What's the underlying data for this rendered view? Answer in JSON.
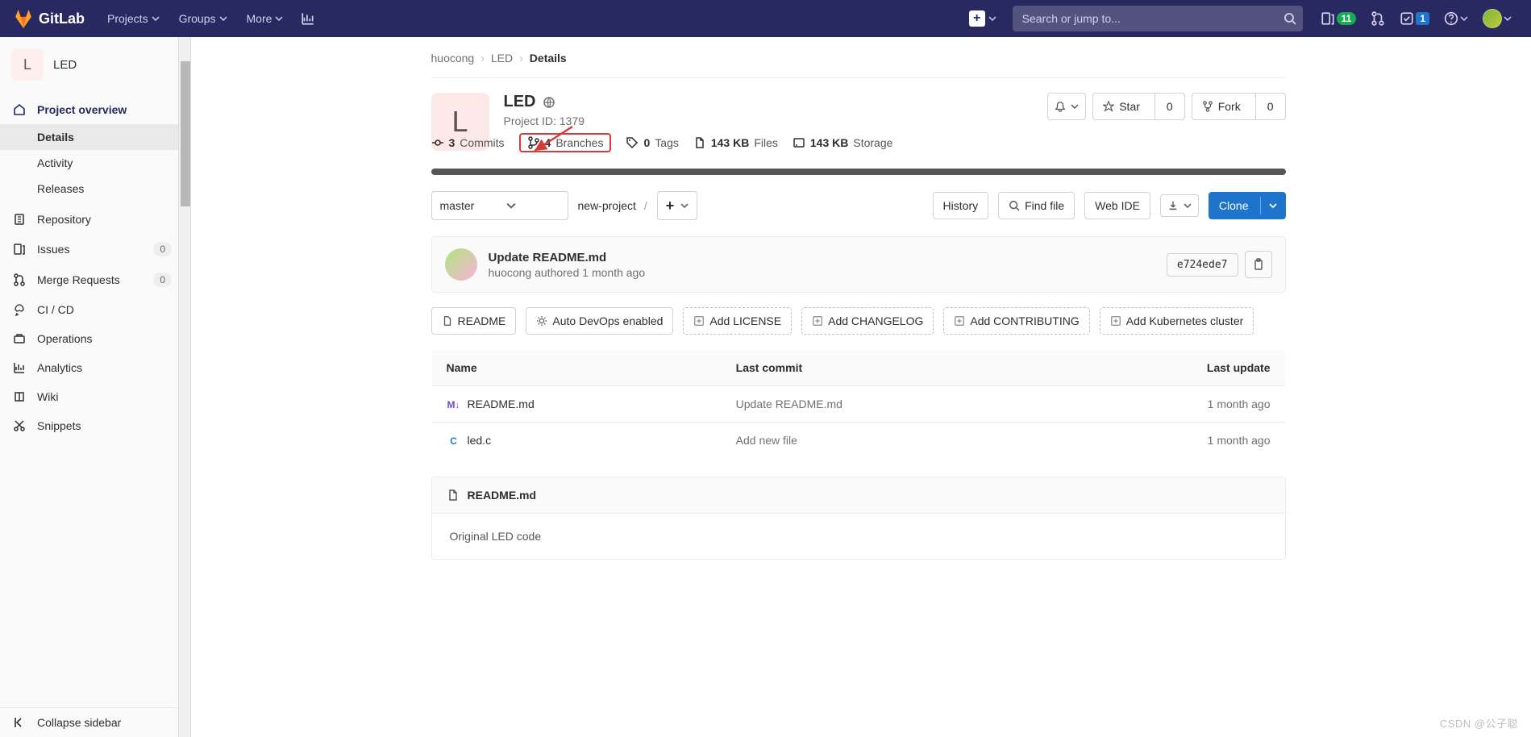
{
  "nav": {
    "brand": "GitLab",
    "projects": "Projects",
    "groups": "Groups",
    "more": "More",
    "search_placeholder": "Search or jump to...",
    "mr_count": "11",
    "todo_count": "1"
  },
  "sidebar": {
    "project_letter": "L",
    "project_name": "LED",
    "items": {
      "overview": "Project overview",
      "details": "Details",
      "activity": "Activity",
      "releases": "Releases",
      "repository": "Repository",
      "issues": "Issues",
      "issues_count": "0",
      "mrs": "Merge Requests",
      "mrs_count": "0",
      "cicd": "CI / CD",
      "operations": "Operations",
      "analytics": "Analytics",
      "wiki": "Wiki",
      "snippets": "Snippets",
      "collapse": "Collapse sidebar"
    }
  },
  "crumbs": {
    "root": "huocong",
    "proj": "LED",
    "page": "Details"
  },
  "project": {
    "letter": "L",
    "name": "LED",
    "id_label": "Project ID: 1379",
    "star_label": "Star",
    "star_count": "0",
    "fork_label": "Fork",
    "fork_count": "0"
  },
  "stats": {
    "commits_n": "3",
    "commits_l": "Commits",
    "branches_n": "4",
    "branches_l": "Branches",
    "tags_n": "0",
    "tags_l": "Tags",
    "files_n": "143 KB",
    "files_l": "Files",
    "storage_n": "143 KB",
    "storage_l": "Storage"
  },
  "branch_row": {
    "branch": "master",
    "path": "new-project",
    "history": "History",
    "find": "Find file",
    "webide": "Web IDE",
    "clone": "Clone"
  },
  "last_commit": {
    "message": "Update README.md",
    "author": "huocong",
    "authored": "authored",
    "age": "1 month ago",
    "sha": "e724ede7"
  },
  "action_buttons": {
    "readme": "README",
    "autodevops": "Auto DevOps enabled",
    "license": "Add LICENSE",
    "changelog": "Add CHANGELOG",
    "contributing": "Add CONTRIBUTING",
    "k8s": "Add Kubernetes cluster"
  },
  "files_table": {
    "h_name": "Name",
    "h_commit": "Last commit",
    "h_update": "Last update",
    "rows": [
      {
        "icon": "M↓",
        "icon_cls": "ico-md",
        "name": "README.md",
        "commit": "Update README.md",
        "update": "1 month ago"
      },
      {
        "icon": "C",
        "icon_cls": "ico-c",
        "name": "led.c",
        "commit": "Add new file",
        "update": "1 month ago"
      }
    ]
  },
  "readme": {
    "filename": "README.md",
    "body": "Original LED code"
  },
  "watermark": "CSDN @公子聪"
}
